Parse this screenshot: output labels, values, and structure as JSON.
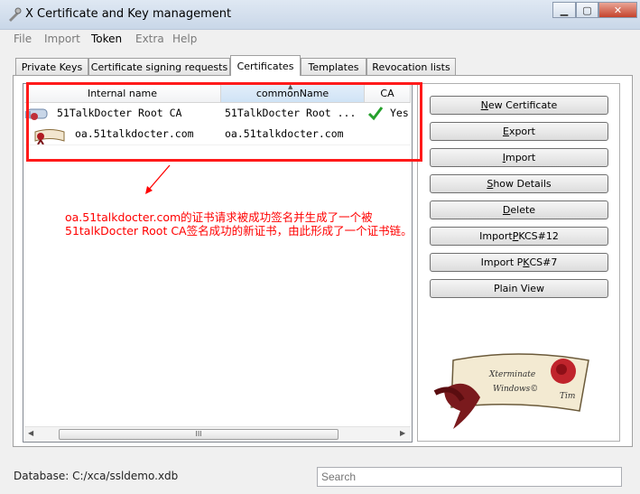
{
  "window": {
    "title": "X Certificate and Key management"
  },
  "menu": [
    {
      "label": "File"
    },
    {
      "label": "Import"
    },
    {
      "label": "Token"
    },
    {
      "label": "Extra"
    },
    {
      "label": "Help"
    }
  ],
  "tabs": [
    {
      "label": "Private Keys"
    },
    {
      "label": "Certificate signing requests"
    },
    {
      "label": "Certificates",
      "active": true
    },
    {
      "label": "Templates"
    },
    {
      "label": "Revocation lists"
    }
  ],
  "table": {
    "columns": [
      "Internal name",
      "commonName",
      "CA"
    ],
    "sorted_column": "commonName",
    "rows": [
      {
        "internal_name": "51TalkDocter Root CA",
        "common_name": "51TalkDocter Root ...",
        "ca": "Yes",
        "ca_checked": true,
        "icon": "ca-certificate-icon"
      },
      {
        "internal_name": "oa.51talkdocter.com",
        "common_name": "oa.51talkdocter.com",
        "ca": "",
        "ca_checked": false,
        "icon": "certificate-icon"
      }
    ],
    "scroll_thumb": "III"
  },
  "annotation": {
    "text": "oa.51talkdocter.com的证书请求被成功签名并生成了一个被51talkDocter Root CA签名成功的新证书，由此形成了一个证书链。",
    "color": "#ff0000"
  },
  "actions": [
    {
      "label": "New Certificate",
      "mnemonic": "N"
    },
    {
      "label": "Export",
      "mnemonic": "E"
    },
    {
      "label": "Import",
      "mnemonic": "I"
    },
    {
      "label": "Show Details",
      "mnemonic": "S"
    },
    {
      "label": "Delete",
      "mnemonic": "D"
    },
    {
      "label": "Import PKCS#12",
      "mnemonic": "P"
    },
    {
      "label": "Import PKCS#7",
      "mnemonic": "K"
    },
    {
      "label": "Plain View",
      "mnemonic": ""
    }
  ],
  "logo": {
    "text": "Xterminate Windows© Tim"
  },
  "statusbar": {
    "database": "Database: C:/xca/ssldemo.xdb",
    "search_placeholder": "Search"
  }
}
